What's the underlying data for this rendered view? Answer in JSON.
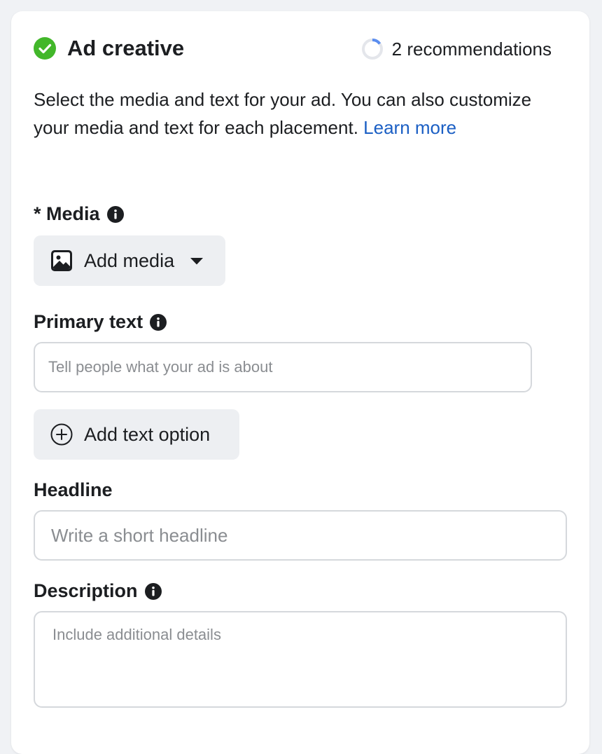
{
  "section": {
    "title": "Ad creative",
    "recommendations": "2 recommendations",
    "intro_text": "Select the media and text for your ad. You can also customize your media and text for each placement.",
    "learn_more": "Learn more"
  },
  "media": {
    "label": "* Media",
    "button_label": "Add media"
  },
  "primary_text": {
    "label": "Primary text",
    "placeholder": "Tell people what your ad is about",
    "add_option_label": "Add text option"
  },
  "headline": {
    "label": "Headline",
    "placeholder": "Write a short headline"
  },
  "description": {
    "label": "Description",
    "placeholder": "Include additional details"
  },
  "icons": {
    "status": "check-circle-icon",
    "recommendations": "progress-ring-icon",
    "info": "info-icon",
    "media": "image-icon",
    "dropdown": "caret-down-icon",
    "add": "plus-circle-icon"
  },
  "colors": {
    "success": "#42b72a",
    "link": "#1b5fc4",
    "button_bg": "#edeff2",
    "progress": "#5b8def"
  }
}
